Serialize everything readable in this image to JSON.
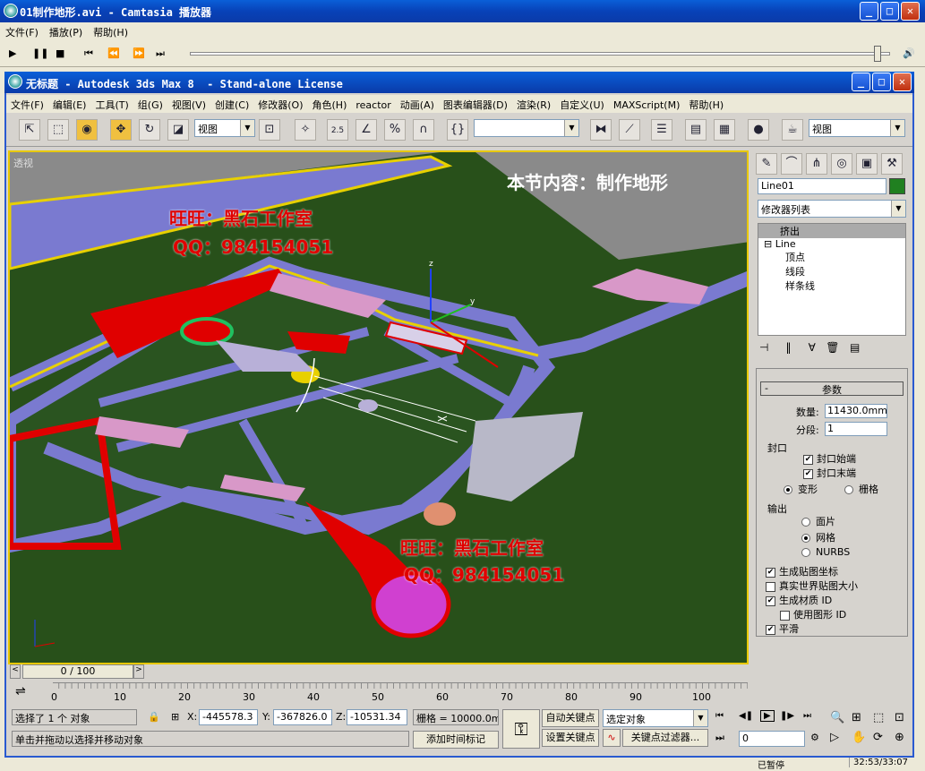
{
  "camtasia": {
    "title": "01制作地形.avi - Camtasia 播放器",
    "menu": [
      "文件(F)",
      "播放(P)",
      "帮助(H)"
    ],
    "status_left": "已暂停",
    "time": "32:53/33:07"
  },
  "max": {
    "title": "无标题 - Autodesk 3ds Max 8  - Stand-alone License",
    "menu": [
      "文件(F)",
      "编辑(E)",
      "工具(T)",
      "组(G)",
      "视图(V)",
      "创建(C)",
      "修改器(O)",
      "角色(H)",
      "reactor",
      "动画(A)",
      "图表编辑器(D)",
      "渲染(R)",
      "自定义(U)",
      "MAXScript(M)",
      "帮助(H)"
    ],
    "toolbar": {
      "view_combo": "视图",
      "view_combo2": "视图",
      "snap_label": "2.5"
    },
    "viewport": {
      "label": "透视",
      "heading": "本节内容：制作地形",
      "watermark1_name": "旺旺：黑石工作室",
      "watermark1_qq": "QQ：984154051",
      "watermark2_name": "旺旺：黑石工作室",
      "watermark2_qq": "QQ：984154051",
      "axis_z": "z",
      "axis_y": "y"
    },
    "command_panel": {
      "object_name": "Line01",
      "modifier_list": "修改器列表",
      "stack_top": "挤出",
      "stack_line": "Line",
      "stack_sub": [
        "顶点",
        "线段",
        "样条线"
      ],
      "params_title": "参数",
      "amount_label": "数量:",
      "amount_value": "11430.0mm",
      "segments_label": "分段:",
      "segments_value": "1",
      "capping_title": "封口",
      "cap_start": "封口始端",
      "cap_end": "封口末端",
      "morph": "变形",
      "grid": "栅格",
      "output_title": "输出",
      "patch": "面片",
      "mesh": "网格",
      "nurbs": "NURBS",
      "gen_map": "生成贴图坐标",
      "real_world": "真实世界贴图大小",
      "gen_mat": "生成材质 ID",
      "use_shape": "使用图形 ID",
      "smooth": "平滑"
    },
    "timeline": {
      "frame_label": "0 / 100",
      "ticks": [
        "0",
        "10",
        "20",
        "30",
        "40",
        "50",
        "60",
        "70",
        "80",
        "90",
        "100"
      ]
    },
    "status": {
      "selected": "选择了 1 个 对象",
      "prompt": "单击并拖动以选择并移动对象",
      "x": "-445578.3",
      "y": "-367826.0",
      "z": "-10531.34",
      "grid": "栅格 = 10000.0mm",
      "add_tag": "添加时间标记",
      "auto_key": "自动关键点",
      "set_key": "设置关键点",
      "selected_obj": "选定对象",
      "key_filter": "关键点过滤器...",
      "frame": "0"
    }
  }
}
